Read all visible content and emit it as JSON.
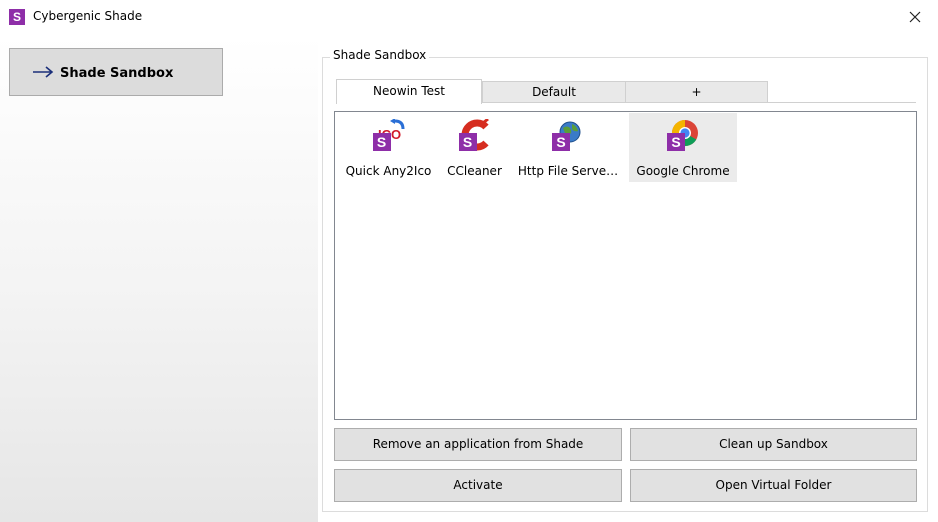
{
  "window": {
    "title": "Cybergenic Shade",
    "app_icon_letter": "S"
  },
  "sidebar": {
    "items": [
      {
        "label": "Shade Sandbox",
        "selected": true
      }
    ]
  },
  "group": {
    "legend": "Shade Sandbox"
  },
  "tabs": [
    {
      "label": "Neowin Test",
      "active": true
    },
    {
      "label": "Default",
      "active": false
    },
    {
      "label": "+",
      "active": false
    }
  ],
  "apps": [
    {
      "label": "Quick Any2Ico",
      "icon": "any2ico-icon"
    },
    {
      "label": "CCleaner",
      "icon": "ccleaner-icon"
    },
    {
      "label": "Http File Serve…",
      "icon": "http-file-server-icon"
    },
    {
      "label": "Google Chrome",
      "icon": "google-chrome-icon",
      "selected": true
    }
  ],
  "buttons": {
    "remove": "Remove an application from Shade",
    "cleanup": "Clean up Sandbox",
    "activate": "Activate",
    "open_folder": "Open Virtual Folder"
  },
  "colors": {
    "brand": "#8e2ea8",
    "button_bg": "#e1e1e1",
    "button_border": "#adadad",
    "selected_bg": "#ebebeb"
  }
}
